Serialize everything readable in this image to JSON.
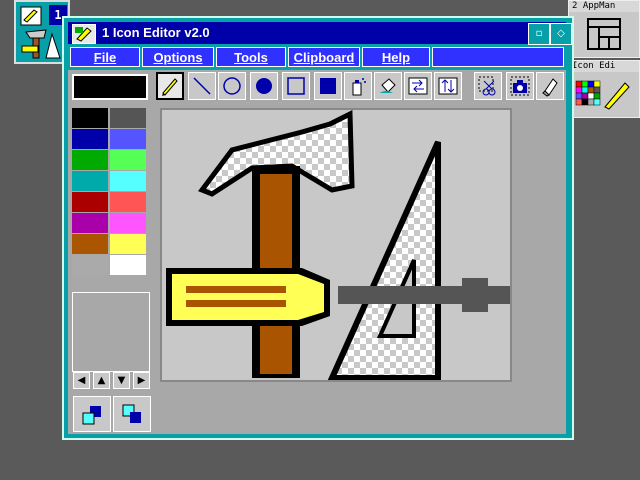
{
  "desktop": {
    "mini_window_number": "1",
    "appman_caption": "2 AppMan",
    "icon_editor_caption": "Icon Edi"
  },
  "window": {
    "title": "1  Icon Editor v2.0",
    "menus": [
      "File",
      "Options",
      "Tools",
      "Clipboard",
      "Help"
    ]
  },
  "tools": [
    "pencil-tool",
    "line-tool",
    "circle-tool",
    "filled-circle-tool",
    "rectangle-tool",
    "filled-rectangle-tool",
    "spray-tool",
    "fill-tool",
    "swap-colors-tool",
    "flip-tool",
    "cut-tool",
    "snapshot-tool",
    "eraser-tool"
  ],
  "selected_tool": "pencil-tool",
  "current_color": "#000000",
  "palette": [
    "#000000",
    "#555555",
    "#0000aa",
    "#5555ff",
    "#00aa00",
    "#55ff55",
    "#00aaaa",
    "#55ffff",
    "#aa0000",
    "#ff5555",
    "#aa00aa",
    "#ff55ff",
    "#aa5500",
    "#ffff55",
    "#aaaaaa",
    "#ffffff"
  ],
  "nav_arrows": [
    "◀",
    "▲",
    "▼",
    "▶"
  ]
}
